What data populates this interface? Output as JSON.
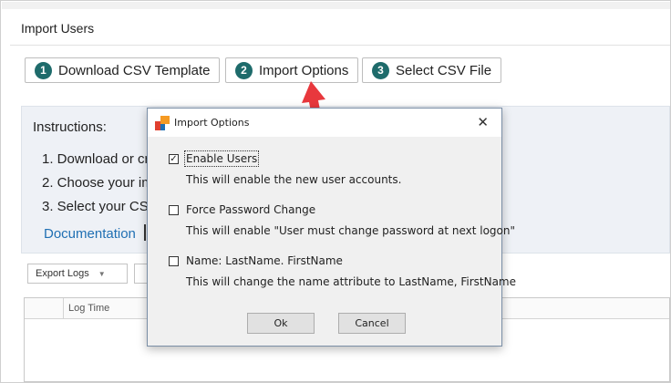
{
  "page": {
    "title": "Import Users"
  },
  "steps": [
    {
      "num": "1",
      "label": "Download CSV Template"
    },
    {
      "num": "2",
      "label": "Import Options"
    },
    {
      "num": "3",
      "label": "Select CSV File"
    }
  ],
  "instructions": {
    "title": "Instructions:",
    "items": [
      "1. Download or cr",
      "2. Choose your im",
      "3. Select your CSV"
    ],
    "doc_link": "Documentation"
  },
  "toolbar": {
    "export_logs": "Export Logs"
  },
  "log_grid": {
    "columns": [
      "Log Time"
    ]
  },
  "dialog": {
    "title": "Import Options",
    "close": "✕",
    "options": [
      {
        "label": "Enable Users",
        "checked": true,
        "desc": "This will enable the new user accounts."
      },
      {
        "label": "Force Password Change",
        "checked": false,
        "desc": "This will enable \"User must change password at next logon\""
      },
      {
        "label": "Name: LastName. FirstName",
        "checked": false,
        "desc": "This will change the name attribute to LastName, FirstName"
      }
    ],
    "ok": "Ok",
    "cancel": "Cancel"
  },
  "colors": {
    "accent": "#1e6b6b",
    "link": "#1f6fb3",
    "arrow": "#e8383d",
    "panel": "#eef1f6"
  }
}
